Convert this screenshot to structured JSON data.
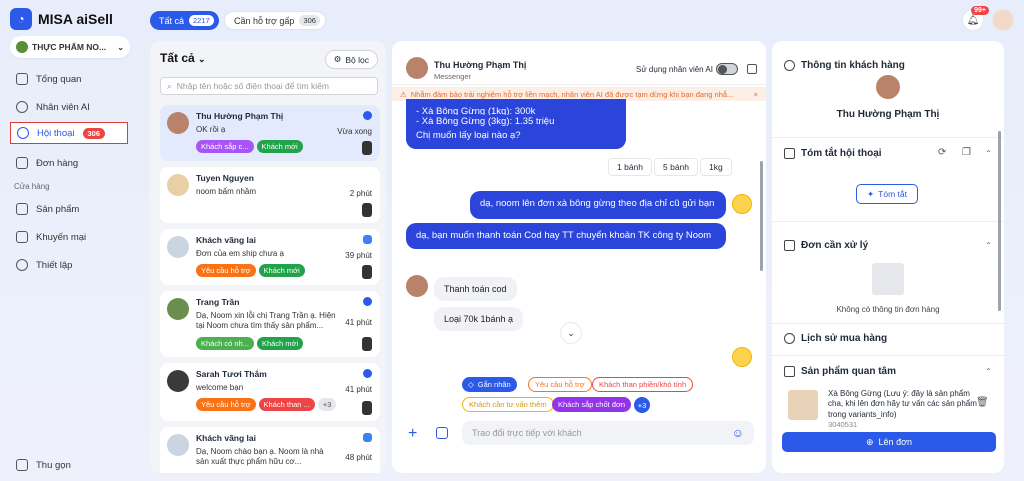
{
  "app": {
    "name": "MISA aiSell"
  },
  "store": {
    "name": "THỰC PHẨM NO..."
  },
  "sidebar": {
    "items": [
      {
        "label": "Tổng quan"
      },
      {
        "label": "Nhân viên AI"
      },
      {
        "label": "Hội thoại",
        "badge": "306"
      },
      {
        "label": "Đơn hàng"
      }
    ],
    "section": "Cửa hàng",
    "store_items": [
      {
        "label": "Sản phẩm"
      },
      {
        "label": "Khuyến mại"
      },
      {
        "label": "Thiết lập"
      }
    ],
    "collapse": "Thu gọn"
  },
  "tabs": {
    "all": {
      "label": "Tất cả",
      "count": "2217"
    },
    "urgent": {
      "label": "Cần hỗ trợ gấp",
      "count": "306"
    }
  },
  "notifications": {
    "badge": "99+"
  },
  "list": {
    "title": "Tất cả",
    "filter": "Bộ lọc",
    "search_placeholder": "Nhập tên hoặc số điện thoại để tìm kiếm",
    "cards": [
      {
        "name": "Thu Hường Phạm Thị",
        "msg": "OK rồi ạ",
        "time": "Vừa xong",
        "tags": [
          "Khách sắp c...",
          "Khách mới"
        ]
      },
      {
        "name": "Tuyen Nguyen",
        "msg": "noom bấm nhầm",
        "time": "2 phút",
        "tags": []
      },
      {
        "name": "Khách vãng lai",
        "msg": "Đơn của em ship chưa ạ",
        "time": "39 phút",
        "tags": [
          "Yêu cầu hỗ trợ",
          "Khách mới"
        ]
      },
      {
        "name": "Trang Trần",
        "msg": "Dạ, Noom xin lỗi chị Trang Trần ạ. Hiện tại Noom chưa tìm thấy sản phẩm...",
        "time": "41 phút",
        "tags": [
          "Khách có nh...",
          "Khách mới"
        ]
      },
      {
        "name": "Sarah Tươi Thắm",
        "msg": "welcome bạn",
        "time": "41 phút",
        "tags": [
          "Yêu cầu hỗ trợ",
          "Khách than ...",
          "+3"
        ]
      },
      {
        "name": "Khách vãng lai",
        "msg": "Dạ, Noom chào bạn ạ. Noom là nhà sản xuất thực phẩm hữu cơ...",
        "time": "48 phút",
        "tags": []
      }
    ]
  },
  "chat": {
    "customer": "Thu Hường Phạm Thị",
    "channel": "Messenger",
    "ai_toggle_label": "Sử dụng nhân viên AI",
    "warning": "Nhằm đảm bảo trải nghiệm hỗ trợ liền mạch, nhân viên AI đã được tạm dừng khi bạn đang nhắ...",
    "msg1_lines": [
      "- Xà Bông Gừng (1kg): 300k",
      "- Xà Bông Gừng (3kg): 1.35 triệu",
      "Chị muốn lấy loại nào ạ?"
    ],
    "quick_replies": [
      "1 bánh",
      "5 bánh",
      "1kg"
    ],
    "msg2": "dạ, noom lên đơn xà bông gừng theo địa chỉ cũ gửi bạn",
    "msg3": "dạ, bạn muốn thanh toán Cod hay TT chuyển khoản TK công ty Noom",
    "reply1": "Thanh toán cod",
    "reply2": "Loại 70k 1bánh ạ",
    "tag_button": "Gắn nhãn",
    "tags": [
      "Yêu cầu hỗ trợ",
      "Khách than phiền/khó tính",
      "Khách cần tư vấn thêm",
      "Khách sắp chốt đơn",
      "+3"
    ],
    "composer_placeholder": "Trao đổi trực tiếp với khách"
  },
  "info": {
    "customer_title": "Thông tin khách hàng",
    "customer_name": "Thu Hường Phạm Thị",
    "summary_title": "Tóm tắt hội thoại",
    "summary_button": "Tóm tắt",
    "pending_title": "Đơn cần xử lý",
    "pending_empty": "Không có thông tin đơn hàng",
    "history_title": "Lịch sử mua hàng",
    "interest_title": "Sản phẩm quan tâm",
    "product_name": "Xà Bông Gừng (Lưu ý: đây là sản phẩm cha, khi lên đơn hãy tư vấn các sản phẩm trong variants_info)",
    "product_code": "3040531",
    "order_button": "Lên đơn"
  },
  "colors": {
    "accent": "#2b59e8",
    "bubble": "#2b44d9",
    "danger": "#ef4444"
  }
}
